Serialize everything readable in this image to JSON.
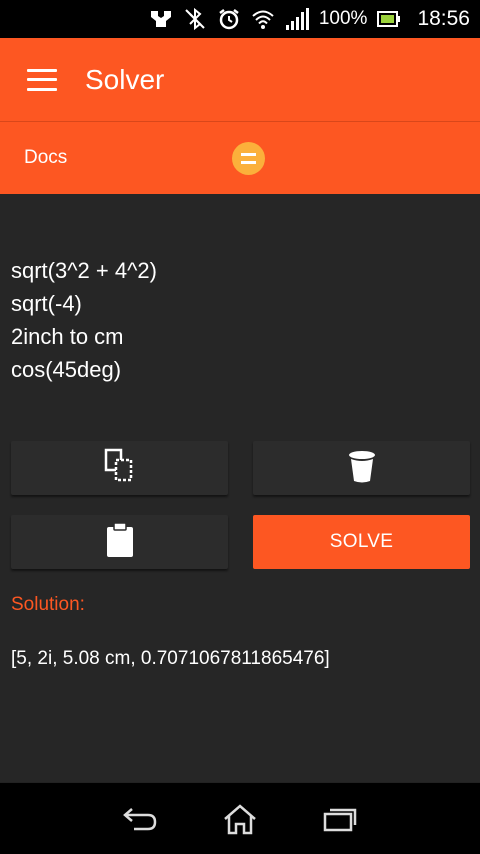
{
  "status_bar": {
    "battery_percent": "100%",
    "time": "18:56",
    "icons": [
      "nfc-icon",
      "bluetooth-off-icon",
      "alarm-icon",
      "wifi-icon",
      "signal-icon",
      "battery-charging-icon"
    ]
  },
  "app_bar": {
    "title": "Solver",
    "menu_icon": "hamburger-menu-icon"
  },
  "tabs": {
    "docs_label": "Docs",
    "equals_icon": "equals-icon"
  },
  "editor": {
    "lines": [
      "sqrt(3^2 + 4^2)",
      "sqrt(-4)",
      "2inch to cm",
      "cos(45deg)"
    ]
  },
  "actions": {
    "copy_icon": "copy-icon",
    "delete_icon": "trash-icon",
    "paste_icon": "clipboard-icon",
    "solve_label": "SOLVE"
  },
  "solution": {
    "label": "Solution:",
    "result": "[5, 2i, 5.08 cm, 0.7071067811865476]"
  },
  "nav_bar": {
    "icons": [
      "back-icon",
      "home-icon",
      "recent-apps-icon"
    ]
  },
  "colors": {
    "accent": "#fd5722",
    "equals_badge": "#fbb03b",
    "content_bg": "#262626",
    "button_bg": "#2c2c2c"
  }
}
